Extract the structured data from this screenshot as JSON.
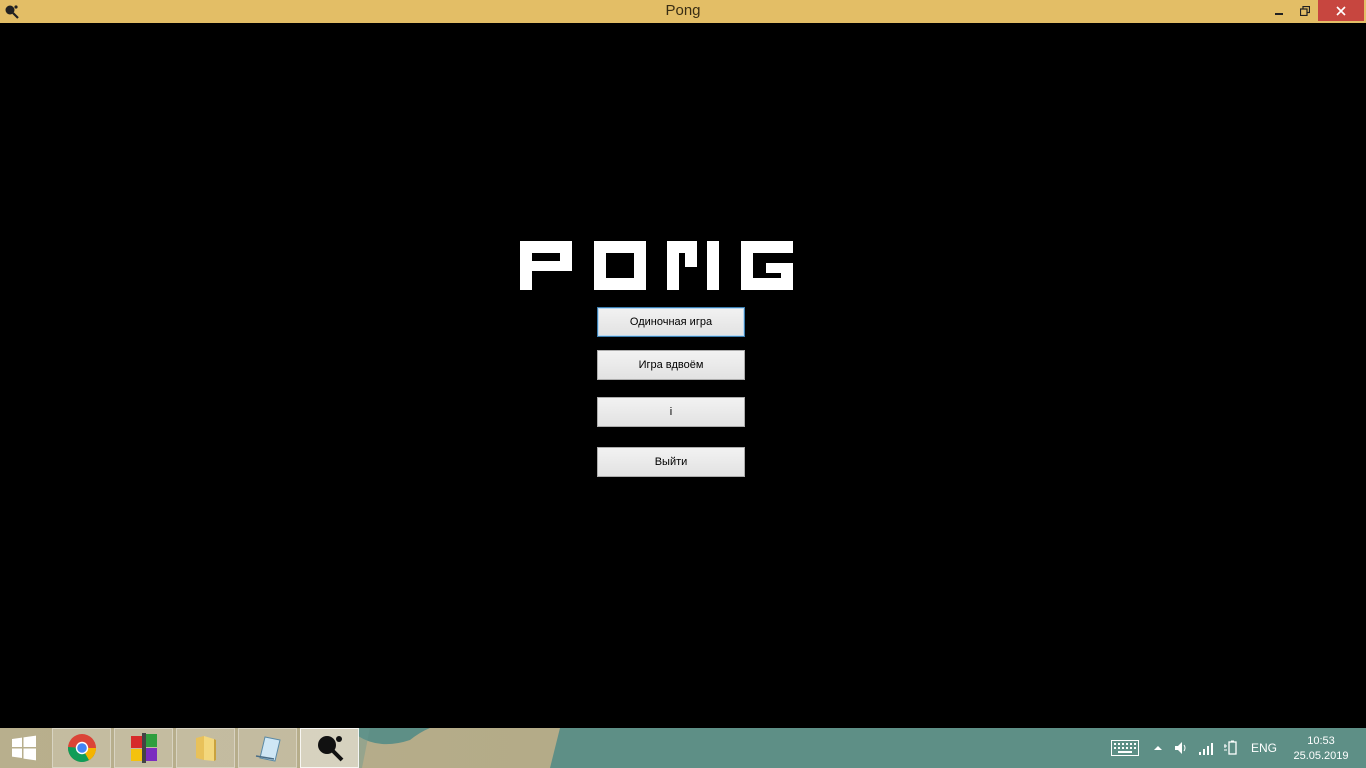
{
  "window": {
    "title": "Pong",
    "app_icon": "ping-pong-paddle-icon"
  },
  "logo": {
    "text": "PONG"
  },
  "menu": {
    "single_player": "Одиночная игра",
    "two_players": "Игра вдвоём",
    "info": "i",
    "exit": "Выйти"
  },
  "taskbar": {
    "apps": [
      "start-windows-icon",
      "chrome-icon",
      "winrar-icon",
      "file-explorer-icon",
      "notepad-icon",
      "pong-app-icon"
    ],
    "language": "ENG",
    "time": "10:53",
    "date": "25.05.2019"
  },
  "colors": {
    "titlebar": "#e3be66",
    "close": "#c7463f",
    "background": "#000000",
    "taskbar": "#b8af8d",
    "taskbar_teal": "#5e8f86"
  }
}
